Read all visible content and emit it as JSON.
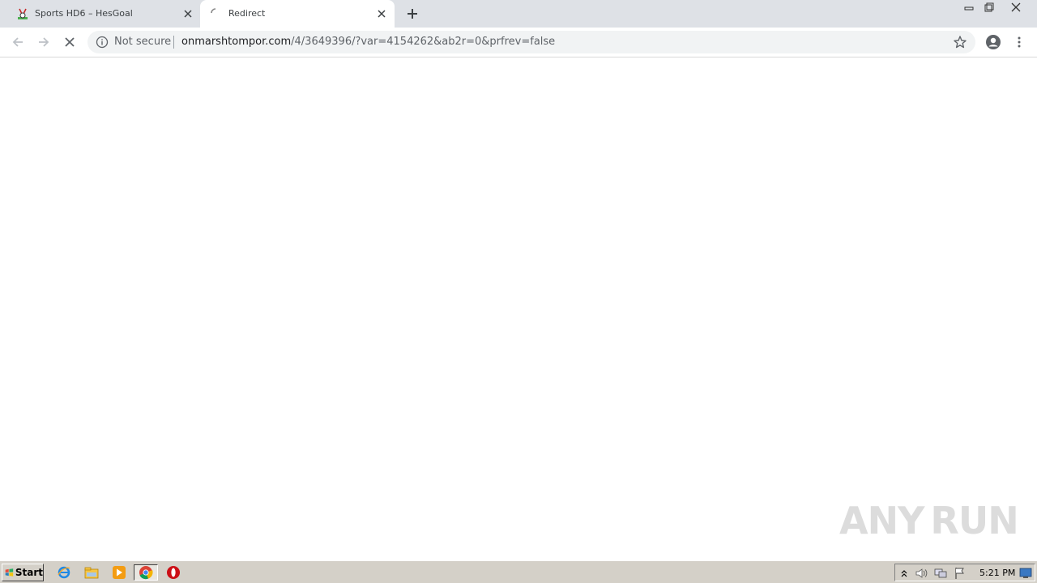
{
  "browser": {
    "tabs": [
      {
        "title": "Sports HD6 – HesGoal",
        "icon": "hesgoal-favicon",
        "active": false
      },
      {
        "title": "Redirect",
        "icon": "loading-spinner-icon",
        "active": true
      }
    ],
    "new_tab_icon": "plus-icon",
    "window_controls": [
      "minimize-icon",
      "restore-icon",
      "close-icon"
    ]
  },
  "toolbar": {
    "security_label": "Not secure",
    "url_host": "onmarshtompor.com",
    "url_rest": "/4/3649396/?var=4154262&ab2r=0&prfrev=false",
    "icons": [
      "back-icon",
      "forward-icon",
      "stop-loading-icon",
      "info-icon",
      "bookmark-star-icon",
      "profile-icon",
      "menu-dots-icon"
    ]
  },
  "watermark": {
    "left": "ANY",
    "right": "RUN"
  },
  "taskbar": {
    "start_label": "Start",
    "clock": "5:21 PM",
    "apps": [
      "internet-explorer-icon",
      "file-explorer-icon",
      "media-player-icon",
      "chrome-icon",
      "opera-icon"
    ],
    "tray": [
      "show-hidden-icon",
      "volume-icon",
      "network-icon",
      "action-center-flag-icon",
      "show-desktop-icon"
    ]
  },
  "colors": {
    "tabstrip": "#dee1e6",
    "omnibox": "#f1f3f4",
    "taskbar": "#d4d0c8"
  }
}
